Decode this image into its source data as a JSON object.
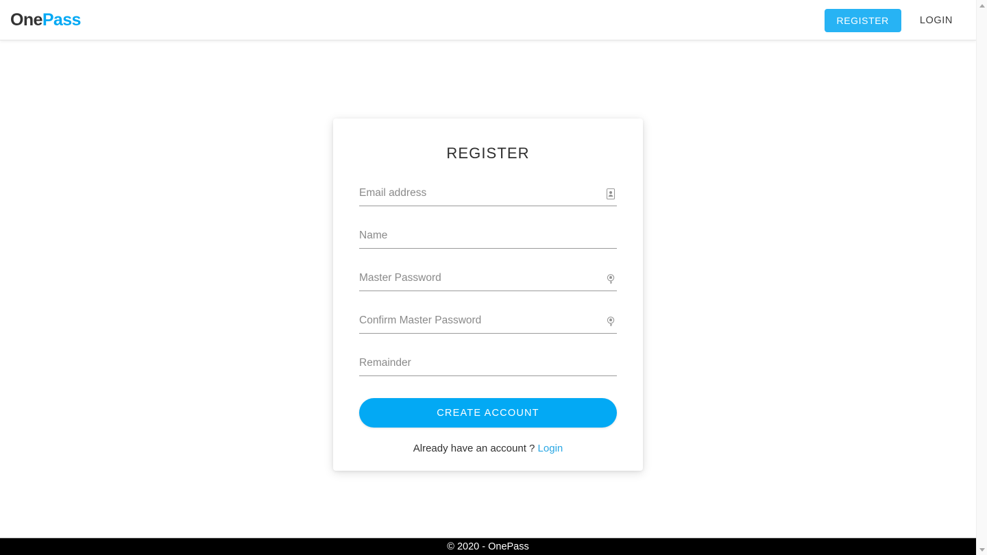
{
  "navbar": {
    "brand": {
      "first": "One",
      "second": "Pass"
    },
    "register_button": "REGISTER",
    "login_link": "LOGIN"
  },
  "card": {
    "title": "REGISTER",
    "fields": [
      {
        "name": "email",
        "placeholder": "Email address",
        "value": "",
        "icon": "contact-card-autofill-icon",
        "type": "text"
      },
      {
        "name": "name",
        "placeholder": "Name",
        "value": "",
        "icon": "",
        "type": "text"
      },
      {
        "name": "master_password",
        "placeholder": "Master Password",
        "value": "",
        "icon": "key-password-manager-icon",
        "type": "password"
      },
      {
        "name": "confirm_master_password",
        "placeholder": "Confirm Master Password",
        "value": "",
        "icon": "key-password-manager-icon",
        "type": "password"
      },
      {
        "name": "remainder",
        "placeholder": "Remainder",
        "value": "",
        "icon": "",
        "type": "text"
      }
    ],
    "submit_button": "CREATE ACCOUNT",
    "footer_text": "Already have an account ?",
    "footer_link": "Login"
  },
  "footer": {
    "copyright": "© 2020 - OnePass"
  },
  "colors": {
    "accent_blue": "#03a9f4",
    "nav_button_blue": "#27b3f4",
    "brand_dark": "#333333",
    "link_blue": "#29a7e4",
    "footer_bg": "#000000",
    "page_bg": "#ffffff",
    "field_underline": "#9a9a9a"
  }
}
